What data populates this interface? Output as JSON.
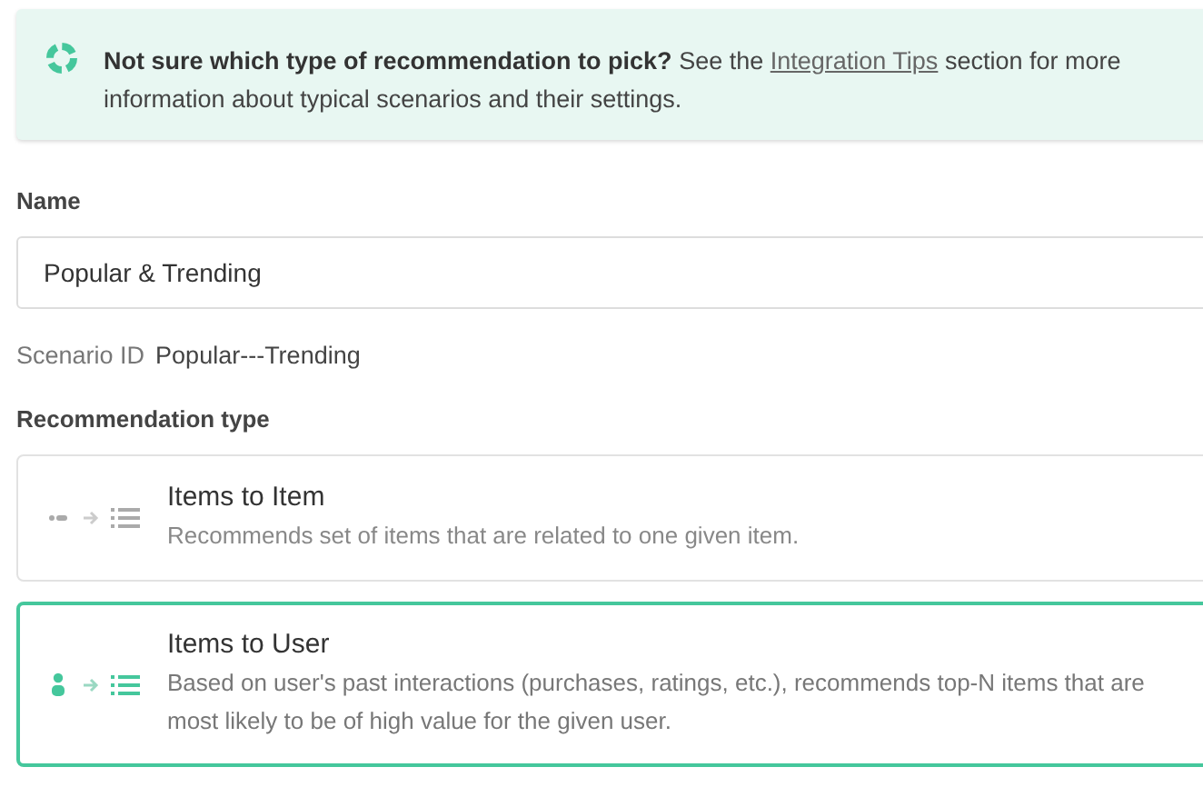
{
  "banner": {
    "lead": "Not sure which type of recommendation to pick?",
    "text_before_link": "See the",
    "link": "Integration Tips",
    "text_after_link": "section for more information about typical scenarios and their settings."
  },
  "name_field": {
    "label": "Name",
    "value": "Popular & Trending"
  },
  "scenario_id": {
    "label": "Scenario ID",
    "value": "Popular---Trending"
  },
  "recommendation_type": {
    "label": "Recommendation type",
    "options": [
      {
        "kind": "items-to-item",
        "title": "Items to Item",
        "description": "Recommends set of items that are related to one given item.",
        "selected": false
      },
      {
        "kind": "items-to-user",
        "title": "Items to User",
        "description": "Based on user's past interactions (purchases, ratings, etc.), recommends top-N items that are most likely to be of high value for the given user.",
        "selected": true
      }
    ]
  }
}
